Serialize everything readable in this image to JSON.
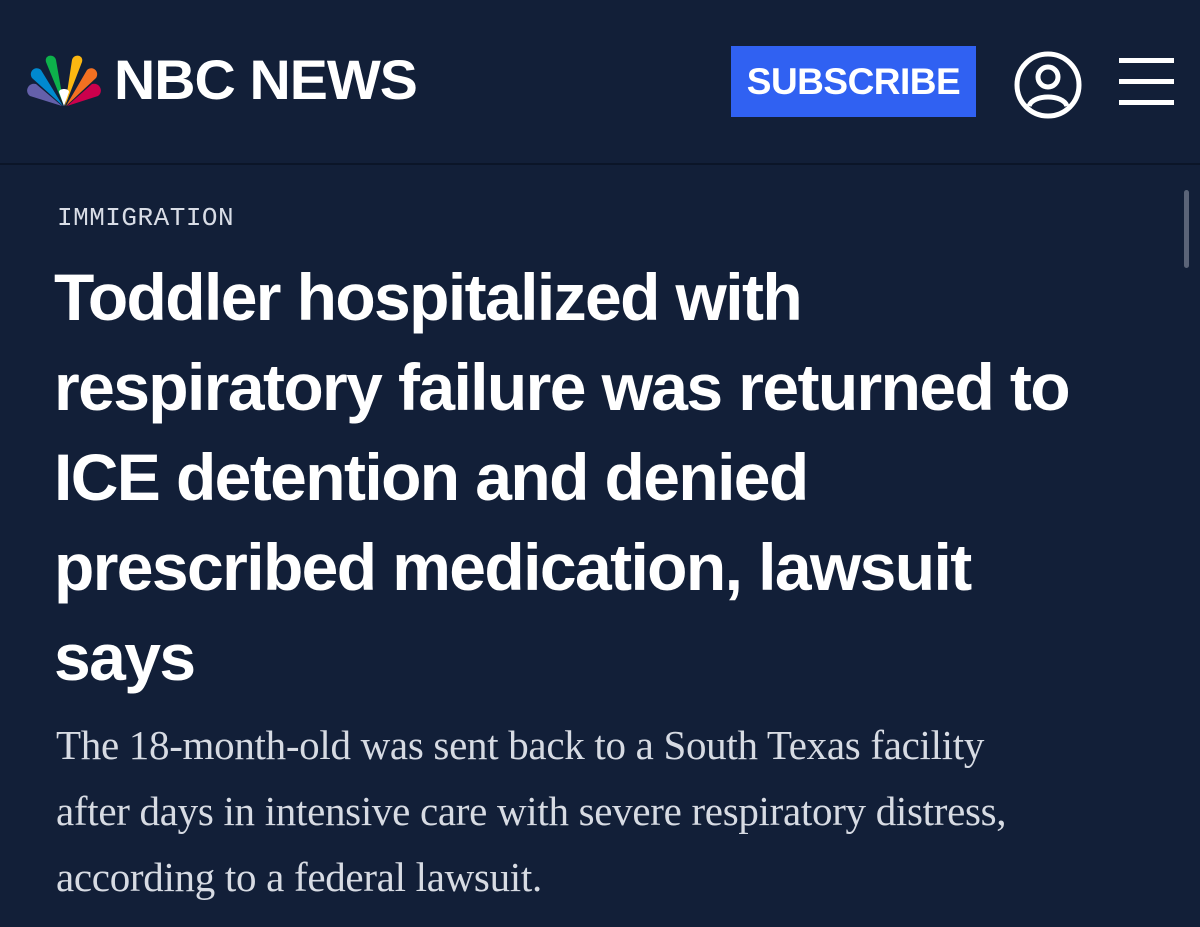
{
  "header": {
    "brand": "NBC NEWS",
    "subscribe_label": "SUBSCRIBE",
    "account_icon": "user-circle-icon",
    "menu_icon": "hamburger-menu-icon",
    "logo_icon": "nbc-peacock-logo"
  },
  "article": {
    "category": "IMMIGRATION",
    "headline_lines": [
      "Toddler hospitalized with",
      "respiratory failure was returned to",
      "ICE detention and denied",
      "prescribed medication, lawsuit",
      "says"
    ],
    "dek_lines": [
      "The 18-month-old was sent back to a South Texas facility",
      "after days in intensive care with severe respiratory distress,",
      "according to a federal lawsuit."
    ]
  },
  "colors": {
    "background": "#121f38",
    "accent": "#3061f2",
    "text": "#ffffff"
  }
}
